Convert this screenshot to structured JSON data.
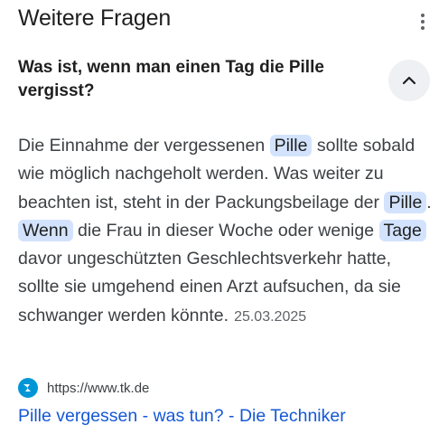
{
  "section": {
    "title": "Weitere Fragen",
    "more_icon": "more-vert-icon"
  },
  "question": {
    "text": "Was ist, wenn man einen Tag die Pille vergisst?",
    "toggle_icon": "chevron-up-icon"
  },
  "answer": {
    "t1": "Die Einnahme der vergessenen ",
    "h1": "Pille",
    "t2": " sollte sobald wie möglich nachgeholt werden. Was weiter zu beachten ist, steht in der Packungsbeilage der ",
    "h2": "Pille",
    "t3": ". ",
    "h3": "Wenn",
    "t4": " die Frau in dieser Woche oder wenige ",
    "h4": "Tage",
    "t5": " davor ungeschützten Geschlechtsverkehr hatte, sollte sie umgehend einen Arzt aufsuchen, da sie schwanger werden könnte.",
    "date": "25.03.2025"
  },
  "source": {
    "favicon": "tk-logo-icon",
    "url": "https://www.tk.de",
    "link_title": "Pille vergessen - was tun? - Die Techniker"
  },
  "colors": {
    "highlight": "#d3e3fd",
    "link": "#1558d6",
    "favicon": "#0096d6"
  }
}
